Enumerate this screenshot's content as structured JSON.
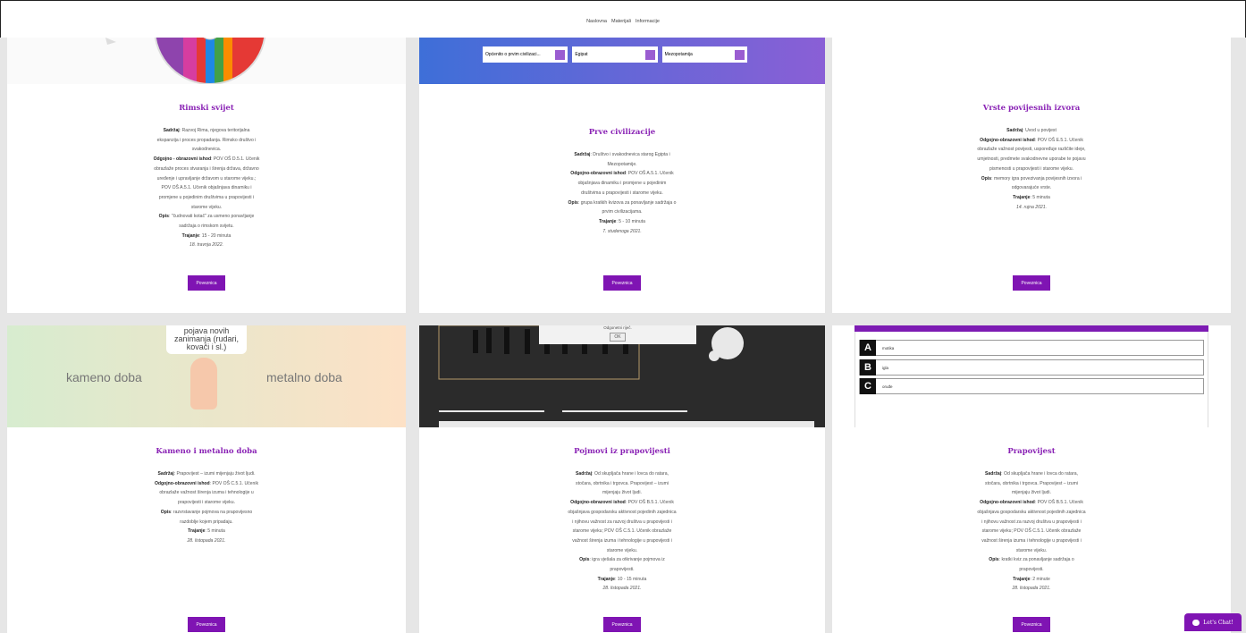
{
  "nav": {
    "items": [
      "Naslovna",
      "Materijali",
      "Informacije"
    ]
  },
  "cards": [
    {
      "title": "Rimski svijet",
      "lines": [
        {
          "b": "Sadržaj",
          "t": ": Razvoj Rima, njegova teritorijalna ekspanzija i proces propadanja. Rimsko društvo i svakodnevica."
        },
        {
          "b": "Odgojno - obrazovni ishod",
          "t": ": POV OŠ D.5.1. Učenik obrazlaže proces stvaranja i širenja država, državno uređenje i upravljanje državom u starome vijeku.; POV OŠ A.5.1. Učenik objašnjava dinamiku i promjene u pojedinim društvima u prapovijesti i starome vijeku."
        },
        {
          "b": "Opis",
          "t": ": \"čudnovati kotač\" za usmeno ponavljanje sadržaja o rimskom svijetu."
        },
        {
          "b": "Trajanje",
          "t": ": 15 - 20 minuta"
        }
      ],
      "date": "18. travnja 2022.",
      "button": "Poveznica"
    },
    {
      "title": "Prve civilizacije",
      "lines": [
        {
          "b": "Sadržaj",
          "t": ": Društvo i svakodnevica starog Egipta i Mezopotamije."
        },
        {
          "b": "Odgojno-obrazovni ishod",
          "t": ": POV OŠ A.5.1. Učenik objašnjava dinamiku i promjene u pojedinim društvima u prapovijesti i starome vijeku."
        },
        {
          "b": "Opis",
          "t": ": grupa kratkih kvizova za ponavljanje sadržaja o prvim civilizacijama."
        },
        {
          "b": "Trajanje",
          "t": ": 5 - 10 minuta"
        }
      ],
      "date": "7. studenoga 2021.",
      "button": "Poveznica",
      "quiz_items": [
        "Općenito o prvim civilizaci...",
        "Egipat",
        "Mezopotamija"
      ]
    },
    {
      "title": "Vrste povijesnih izvora",
      "lines": [
        {
          "b": "Sadržaj",
          "t": ": Uvod u povijest"
        },
        {
          "b": "Odgojno-obrazovni ishod",
          "t": ": POV OŠ E.5.1. Učenik obrazlaže važnost povijesti, uspoređuje različite ideje, umjetnosti, predmete svakodnevne uporabe te pojavu pismenosti u prapovijesti i starome vijeku."
        },
        {
          "b": "Opis",
          "t": ": memory igra povezivanja povijesnih izvora i odgovarajuće vrste."
        },
        {
          "b": "Trajanje",
          "t": ": 5 minuta"
        }
      ],
      "date": "14. rujna 2021.",
      "button": "Poveznica"
    },
    {
      "title": "Kameno i metalno doba",
      "lines": [
        {
          "b": "Sadržaj",
          "t": ": Prapovijest – izumi mijenjaju život ljudi."
        },
        {
          "b": "Odgojno-obrazovni ishod",
          "t": ": POV OŠ C.5.1. Učenik obrazlaže važnost širenja izuma i tehnologije u prapovijesti i starome vijeku."
        },
        {
          "b": "Opis",
          "t": ": razvrstavanje pojmova na prapovijesno razdoblje kojem pripadaju."
        },
        {
          "b": "Trajanje",
          "t": ": 5 minuta"
        }
      ],
      "date": "28. listopada 2021.",
      "button": "Poveznica",
      "thumb_labels": {
        "left": "kameno doba",
        "right": "metalno doba",
        "card": "pojava novih zanimanja (rudari, kovači i sl.)"
      }
    },
    {
      "title": "Pojmovi iz prapovijesti",
      "lines": [
        {
          "b": "Sadržaj",
          "t": ": Od skupljača hrane i lovca do ratara, stočara, obrtnika i trgovca. Prapovijest – izumi mijenjaju život ljudi."
        },
        {
          "b": "Odgojno-obrazovni ishod",
          "t": ": POV OŠ B.5.1. Učenik objašnjava gospodarsku aktivnost pojedinih zajednica i njihovu važnost za razvoj društva u prapovijesti i starome vijeku; POV OŠ C.5.1. Učenik obrazlaže važnost širenja izuma i tehnologije u prapovijesti i starome vijeku."
        },
        {
          "b": "Opis",
          "t": ": igra vješala za otkrivanje pojmova iz prapovijesti."
        },
        {
          "b": "Trajanje",
          "t": ": 10 - 15 minuta"
        }
      ],
      "date": "28. listopada 2021.",
      "button": "Poveznica",
      "dialog": {
        "text": "Odgonetni riječ.",
        "ok": "OK"
      }
    },
    {
      "title": "Prapovijest",
      "lines": [
        {
          "b": "Sadržaj",
          "t": ": Od skupljača hrane i lovca do ratara, stočara, obrtnika i trgovca. Prapovijest – izumi mijenjaju život ljudi."
        },
        {
          "b": "Odgojno-obrazovni ishod",
          "t": ": POV OŠ B.5.1. Učenik objašnjava gospodarsku aktivnost pojedinih zajednica i njihovu važnost za razvoj društva u prapovijesti i starome vijeku; POV OŠ C.5.1. Učenik obrazlaže važnost širenja izuma i tehnologije u prapovijesti i starome vijeku."
        },
        {
          "b": "Opis",
          "t": ": kratki kviz za ponavljanje sadržaja o prapovijesti."
        },
        {
          "b": "Trajanje",
          "t": ": 2 minute"
        }
      ],
      "date": "28. listopada 2021.",
      "button": "Poveznica",
      "quiz": [
        {
          "l": "A",
          "t": "motika"
        },
        {
          "l": "B",
          "t": "igla"
        },
        {
          "l": "C",
          "t": "oruđe"
        }
      ]
    }
  ],
  "chat": {
    "label": "Let's Chat!"
  },
  "colors": {
    "accent": "#7f14b3",
    "title": "#8a23b5",
    "background": "#e6e6e6"
  }
}
